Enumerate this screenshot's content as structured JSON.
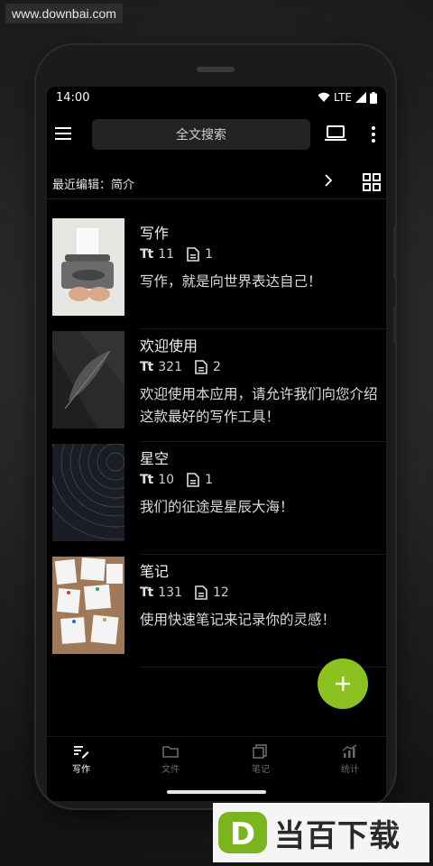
{
  "watermark": "www.downbai.com",
  "status": {
    "time": "14:00",
    "network": "LTE"
  },
  "toolbar": {
    "search_label": "全文搜索"
  },
  "recent": {
    "label": "最近编辑：简介"
  },
  "works": [
    {
      "title": "写作",
      "words": "11",
      "files": "1",
      "desc": "写作，就是向世界表达自己！"
    },
    {
      "title": "欢迎使用",
      "words": "321",
      "files": "2",
      "desc": "欢迎使用本应用，请允许我们向您介绍这款最好的写作工具！"
    },
    {
      "title": "星空",
      "words": "10",
      "files": "1",
      "desc": "我们的征途是星辰大海！"
    },
    {
      "title": "笔记",
      "words": "131",
      "files": "12",
      "desc": "使用快速笔记来记录你的灵感！"
    }
  ],
  "icons": {
    "words": "Tt",
    "fab": "+"
  },
  "nav": [
    {
      "label": "写作",
      "icon": "write-icon",
      "active": true
    },
    {
      "label": "文件",
      "icon": "folder-icon",
      "active": false
    },
    {
      "label": "笔记",
      "icon": "notes-icon",
      "active": false
    },
    {
      "label": "统计",
      "icon": "stats-icon",
      "active": false
    }
  ],
  "brand": {
    "text": "当百下载",
    "logo_letter": "D"
  },
  "colors": {
    "accent": "#8cc21f",
    "background": "#000000",
    "brand_green": "#7ab51d"
  }
}
